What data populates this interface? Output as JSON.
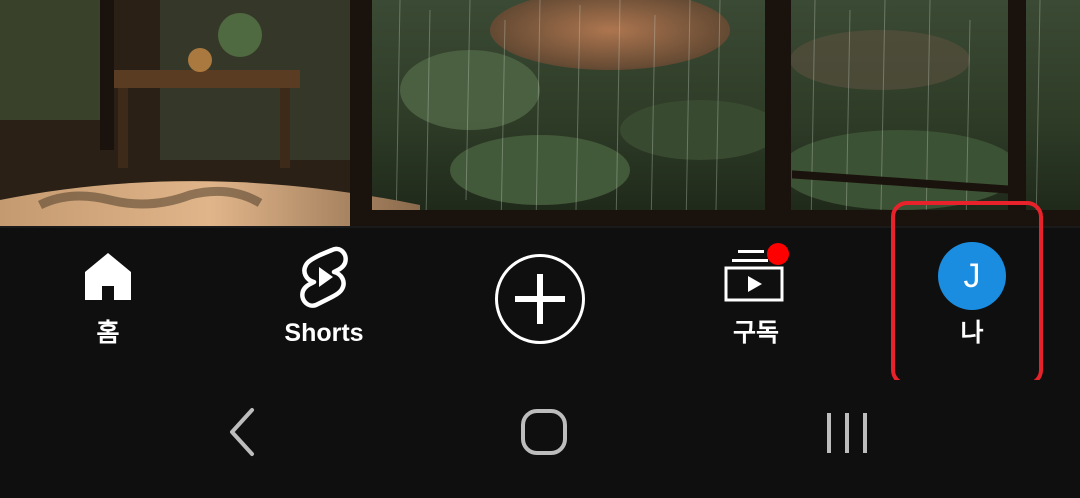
{
  "video": {
    "description_icon": "video-thumbnail"
  },
  "bottom_nav": {
    "items": [
      {
        "id": "home",
        "label": "홈",
        "icon": "home-icon"
      },
      {
        "id": "shorts",
        "label": "Shorts",
        "icon": "shorts-icon"
      },
      {
        "id": "create",
        "label": "",
        "icon": "plus-circle-icon"
      },
      {
        "id": "subscriptions",
        "label": "구독",
        "icon": "subscriptions-icon",
        "badge": true
      },
      {
        "id": "you",
        "label": "나",
        "icon": "avatar",
        "avatar_letter": "J"
      }
    ],
    "highlighted_item": "you"
  },
  "colors": {
    "background": "#0f0f0f",
    "text": "#ffffff",
    "avatar": "#1a8de0",
    "badge": "#ff0000",
    "highlight": "#e8222a"
  },
  "system_nav": {
    "buttons": [
      "back-icon",
      "home-circle-icon",
      "recents-icon"
    ]
  }
}
